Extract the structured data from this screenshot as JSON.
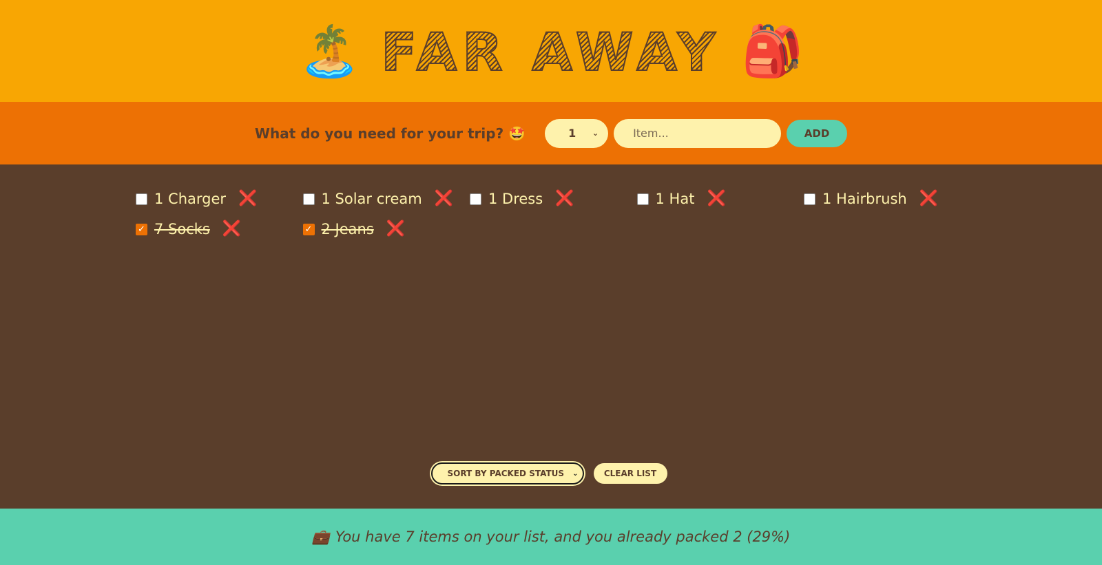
{
  "header": {
    "left_emoji": "🏝️",
    "title": "FAR AWAY",
    "right_emoji": "🎒"
  },
  "add_form": {
    "prompt": "What do you need for your trip? 🤩",
    "quantity": {
      "selected": "1"
    },
    "item_input": {
      "value": "",
      "placeholder": "Item..."
    },
    "add_label": "ADD"
  },
  "list": {
    "items": [
      {
        "quantity": 1,
        "description": "Charger",
        "label": "1 Charger",
        "packed": false,
        "delete_icon": "❌"
      },
      {
        "quantity": 1,
        "description": "Solar cream",
        "label": "1 Solar cream",
        "packed": false,
        "delete_icon": "❌"
      },
      {
        "quantity": 1,
        "description": "Dress",
        "label": "1 Dress",
        "packed": false,
        "delete_icon": "❌"
      },
      {
        "quantity": 1,
        "description": "Hat",
        "label": "1 Hat",
        "packed": false,
        "delete_icon": "❌"
      },
      {
        "quantity": 1,
        "description": "Hairbrush",
        "label": "1 Hairbrush",
        "packed": false,
        "delete_icon": "❌"
      },
      {
        "quantity": 7,
        "description": "Socks",
        "label": "7 Socks",
        "packed": true,
        "delete_icon": "❌"
      },
      {
        "quantity": 2,
        "description": "Jeans",
        "label": "2 Jeans",
        "packed": true,
        "delete_icon": "❌"
      }
    ],
    "actions": {
      "sort_selected": "SORT BY PACKED STATUS",
      "clear_label": "CLEAR LIST"
    }
  },
  "stats": {
    "icon": "💼",
    "text": "You have 7 items on your list, and you already packed 2 (29%)",
    "total_items": 7,
    "packed_items": 2,
    "packed_percent": 29
  },
  "colors": {
    "header_bg": "#f8a603",
    "form_bg": "#ed7104",
    "list_bg": "#5a3e2b",
    "footer_bg": "#5ad0ae",
    "text_light": "#fef2ac",
    "text_dark": "#5a3e2b",
    "delete_red": "#e0222a"
  }
}
